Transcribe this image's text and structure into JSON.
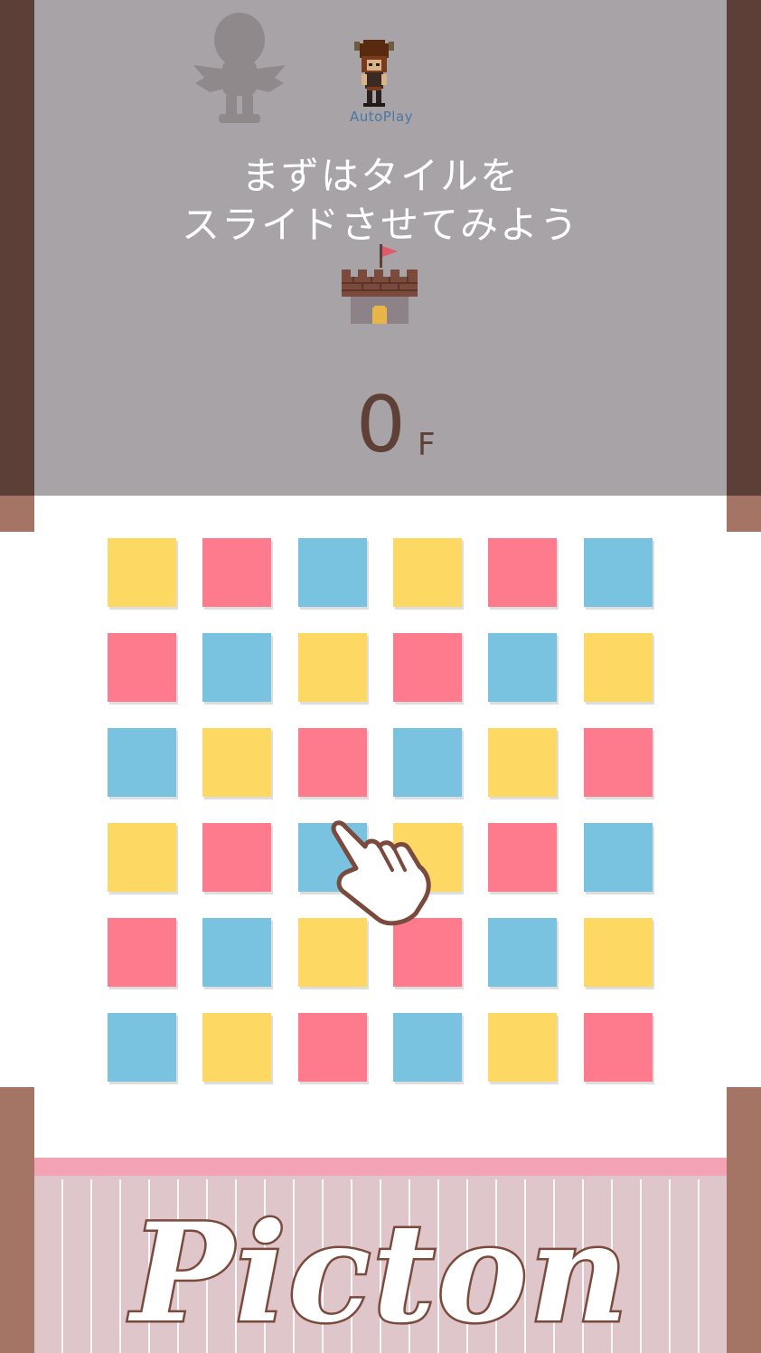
{
  "autoplay_label": "AutoPlay",
  "message": {
    "line1": "まずはタイルを",
    "line2": "スライドさせてみよう"
  },
  "floor": {
    "value": "0",
    "unit": "F"
  },
  "logo_text": "Picton",
  "colors": {
    "yellow": "#fdd863",
    "pink": "#fd7b8d",
    "blue": "#7ac3e0",
    "overlay": "#a7a3a7",
    "pillar_dark": "#5c4037",
    "pillar_light": "#a47565"
  },
  "board": {
    "rows": [
      [
        "yellow",
        "pink",
        "blue",
        "yellow",
        "pink",
        "blue"
      ],
      [
        "pink",
        "blue",
        "yellow",
        "pink",
        "blue",
        "yellow"
      ],
      [
        "blue",
        "yellow",
        "pink",
        "blue",
        "yellow",
        "pink"
      ],
      [
        "yellow",
        "pink",
        "blue",
        "yellow",
        "pink",
        "blue"
      ],
      [
        "pink",
        "blue",
        "yellow",
        "pink",
        "blue",
        "yellow"
      ],
      [
        "blue",
        "yellow",
        "pink",
        "blue",
        "yellow",
        "pink"
      ]
    ]
  },
  "icons": [
    "angel-icon",
    "viking-avatar-icon",
    "castle-icon",
    "pointing-hand-icon"
  ]
}
